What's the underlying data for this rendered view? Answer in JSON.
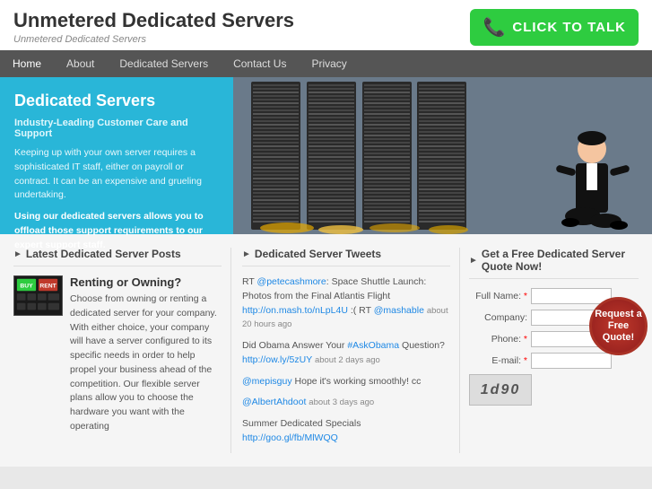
{
  "header": {
    "site_title": "Unmetered Dedicated Servers",
    "site_subtitle": "Unmetered Dedicated Servers",
    "cta_button": "CLICK TO TALK"
  },
  "nav": {
    "items": [
      {
        "label": "Home",
        "active": true
      },
      {
        "label": "About",
        "active": false
      },
      {
        "label": "Dedicated Servers",
        "active": false
      },
      {
        "label": "Contact Us",
        "active": false
      },
      {
        "label": "Privacy",
        "active": false
      }
    ]
  },
  "hero": {
    "title": "Dedicated Servers",
    "subtitle": "Industry-Leading Customer Care and Support",
    "body": "Keeping up with your own server requires a sophisticated IT staff, either on payroll or contract. It can be an expensive and grueling undertaking.",
    "bold_text": "Using our dedicated servers allows you to offload those support requirements to our expert support staff."
  },
  "posts": {
    "section_title": "Latest Dedicated Server Posts",
    "items": [
      {
        "title": "Renting or Owning?",
        "body": "Choose from owning or renting a dedicated server for your company. With either choice, your company will have a server configured to its specific needs in order to help propel your business ahead of the competition. Our flexible server plans allow you to choose the hardware you want with the operating"
      }
    ]
  },
  "tweets": {
    "section_title": "Dedicated Server Tweets",
    "items": [
      {
        "text": "RT ",
        "user": "@petecashmore",
        "content": ": Space Shuttle Launch: Photos from the Final Atlantis Flight ",
        "link1": "http://on.mash.to/nLpL4U",
        "link2": "",
        "time": "about 20 hours ago",
        "suffix": ":( RT ",
        "user2": "@mashable",
        "time2": "about 20 hours ago"
      },
      {
        "user": "",
        "content": "Did Obama Answer Your ",
        "hashtag": "#AskObama",
        "content2": " Question? ",
        "link": "http://ow.ly/5zUY",
        "time": "about 2 days ago"
      },
      {
        "user": "@mepisguy",
        "content": " Hope it's working smoothly! cc"
      },
      {
        "user": "@AlbertAhdoot",
        "time": "about 3 days ago"
      },
      {
        "content": "Summer Dedicated Specials ",
        "link": "http://goo.gl/fb/MlWQQ"
      }
    ]
  },
  "quote": {
    "section_title": "Get a Free Dedicated Server Quote Now!",
    "fields": [
      {
        "label": "Full Name:",
        "required": true
      },
      {
        "label": "Company:",
        "required": false
      },
      {
        "label": "Phone:",
        "required": true
      },
      {
        "label": "E-mail:",
        "required": true
      }
    ],
    "button": "Request a Free Quote!",
    "captcha": "1d90"
  }
}
